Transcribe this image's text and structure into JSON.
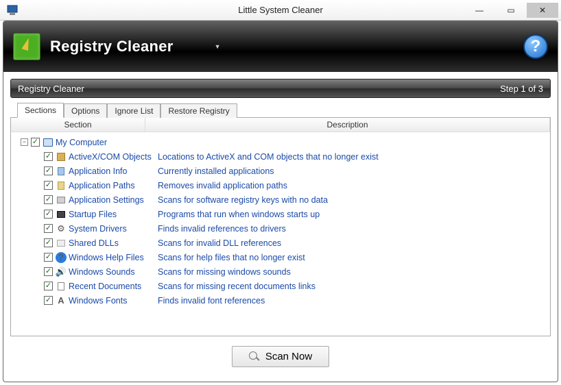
{
  "window_title": "Little System Cleaner",
  "win_buttons": {
    "min": "—",
    "max": "▭",
    "close": "✕"
  },
  "header": {
    "title": "Registry Cleaner",
    "dropdown_glyph": "▼"
  },
  "help_glyph": "?",
  "step_bar": {
    "left": "Registry Cleaner",
    "right": "Step 1 of 3"
  },
  "tabs": [
    {
      "label": "Sections",
      "active": true
    },
    {
      "label": "Options",
      "active": false
    },
    {
      "label": "Ignore List",
      "active": false
    },
    {
      "label": "Restore Registry",
      "active": false
    }
  ],
  "columns": {
    "section": "Section",
    "description": "Description"
  },
  "tree": {
    "root": {
      "label": "My Computer",
      "checked": true,
      "expanded": true
    },
    "items": [
      {
        "label": "ActiveX/COM Objects",
        "desc": "Locations to ActiveX and COM objects that no longer exist",
        "icon": "activex-icon",
        "checked": true
      },
      {
        "label": "Application Info",
        "desc": "Currently installed applications",
        "icon": "appinfo-icon",
        "checked": true
      },
      {
        "label": "Application Paths",
        "desc": "Removes invalid application paths",
        "icon": "apppaths-icon",
        "checked": true
      },
      {
        "label": "Application Settings",
        "desc": "Scans for software registry keys with no data",
        "icon": "appsettings-icon",
        "checked": true
      },
      {
        "label": "Startup Files",
        "desc": "Programs that run when windows starts up",
        "icon": "startup-icon",
        "checked": true
      },
      {
        "label": "System Drivers",
        "desc": "Finds invalid references to drivers",
        "icon": "drivers-icon",
        "checked": true
      },
      {
        "label": "Shared DLLs",
        "desc": "Scans for invalid DLL references",
        "icon": "dlls-icon",
        "checked": true
      },
      {
        "label": "Windows Help Files",
        "desc": "Scans for help files that no longer exist",
        "icon": "help-files-icon",
        "checked": true
      },
      {
        "label": "Windows Sounds",
        "desc": "Scans for missing windows sounds",
        "icon": "sounds-icon",
        "checked": true
      },
      {
        "label": "Recent Documents",
        "desc": "Scans for missing recent documents links",
        "icon": "recent-icon",
        "checked": true
      },
      {
        "label": "Windows Fonts",
        "desc": "Finds invalid font references",
        "icon": "fonts-icon",
        "checked": true
      }
    ]
  },
  "scan_button": "Scan Now"
}
